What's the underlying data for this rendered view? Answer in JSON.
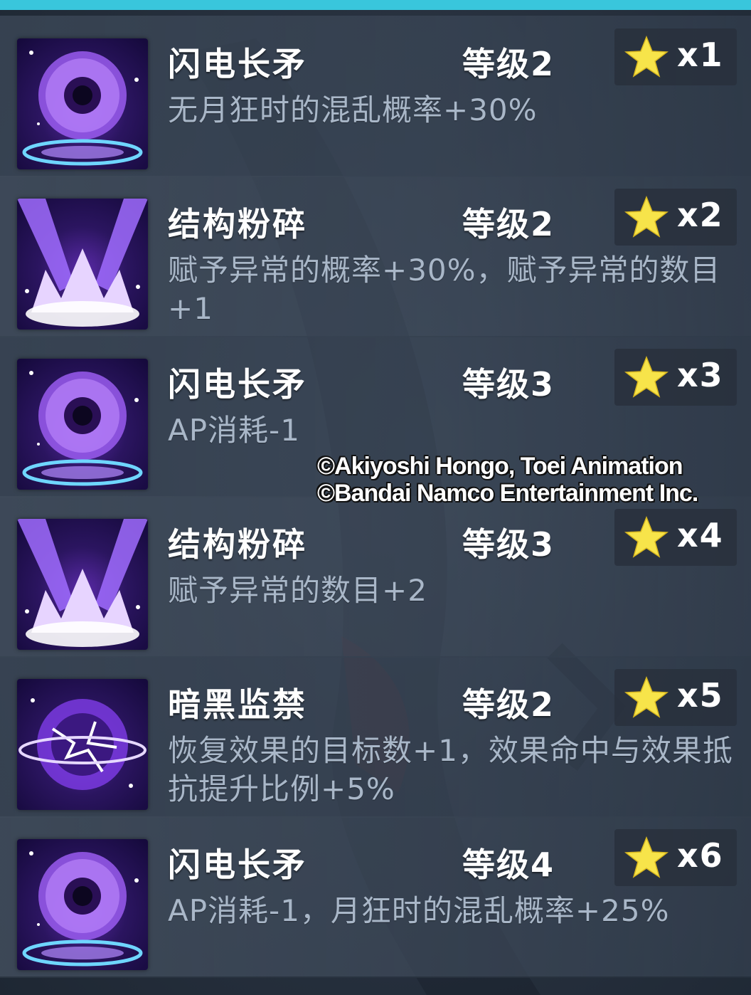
{
  "theme": {
    "accent_bar": "#39c6dc",
    "description_color": "#a9b7c8",
    "star_color": "#f7e44a"
  },
  "skills": [
    {
      "name": "闪电长矛",
      "level": "等级2",
      "star_icon": "star-icon",
      "count": "x1",
      "icon": "lightning-spear-icon",
      "description": "无月狂时的混乱概率+30%"
    },
    {
      "name": "结构粉碎",
      "level": "等级2",
      "star_icon": "star-icon",
      "count": "x2",
      "icon": "structure-shatter-icon",
      "description": "赋予异常的概率+30%，赋予异常的数目+1"
    },
    {
      "name": "闪电长矛",
      "level": "等级3",
      "star_icon": "star-icon",
      "count": "x3",
      "icon": "lightning-spear-icon",
      "description": "AP消耗-1"
    },
    {
      "name": "结构粉碎",
      "level": "等级3",
      "star_icon": "star-icon",
      "count": "x4",
      "icon": "structure-shatter-icon",
      "description": "赋予异常的数目+2"
    },
    {
      "name": "暗黑监禁",
      "level": "等级2",
      "star_icon": "star-icon",
      "count": "x5",
      "icon": "dark-prison-icon",
      "description": "恢复效果的目标数+1，效果命中与效果抵抗提升比例+5%"
    },
    {
      "name": "闪电长矛",
      "level": "等级4",
      "star_icon": "star-icon",
      "count": "x6",
      "icon": "lightning-spear-icon",
      "description": "AP消耗-1，月狂时的混乱概率+25%"
    }
  ],
  "watermark": {
    "line1": "©Akiyoshi Hongo, Toei Animation",
    "line2": "©Bandai Namco Entertainment Inc."
  }
}
